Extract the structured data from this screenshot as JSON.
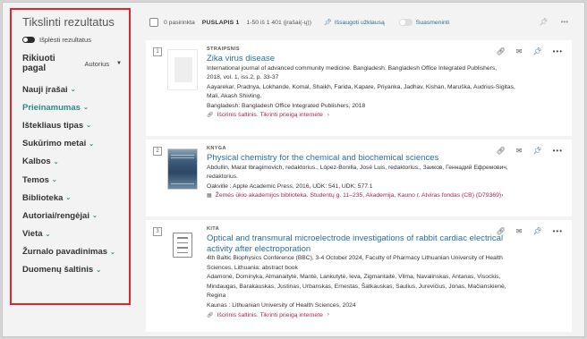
{
  "sidebar": {
    "title": "Tikslinti rezultatus",
    "expand_label": "Išplėsti rezultatus",
    "sort_label": "Rikiuoti pagal",
    "sort_value": "Autorius",
    "facets": [
      {
        "label": "Nauji įrašai",
        "active": false
      },
      {
        "label": "Prieinamumas",
        "active": true
      },
      {
        "label": "Ištekliaus tipas",
        "active": false
      },
      {
        "label": "Sukūrimo metai",
        "active": false
      },
      {
        "label": "Kalbos",
        "active": false
      },
      {
        "label": "Temos",
        "active": false
      },
      {
        "label": "Biblioteka",
        "active": false
      },
      {
        "label": "Autoriai/rengėjai",
        "active": false
      },
      {
        "label": "Vieta",
        "active": false
      },
      {
        "label": "Žurnalo pavadinimas",
        "active": false
      },
      {
        "label": "Duomenų šaltinis",
        "active": false
      }
    ]
  },
  "toolbar": {
    "selected": "0 pasirinkta",
    "page": "PUSLAPIS 1",
    "range": "1-50 iš 1 401 (įrašai(-ų))",
    "save_query": "Išsaugoti užklausą",
    "personalize": "Suasmeninti"
  },
  "results": [
    {
      "num": "1",
      "type": "STRAIPSNIS",
      "title": "Zika virus disease",
      "lines": [
        "International journal of advanced community medicine. Bangladesh: Bangladesh Office Integrated Publishers,",
        "2018, vol. 1, iss.2, p. 33-37",
        "Aayarekar, Pradnya, Lokhande, Komal, Shaikh, Farida, Kapare, Priyanka, Jadhav, Kishan, Maruška, Audrius-Sigitas,",
        "Mali, Akash Shivling.",
        "Bangladesh: Bangladesh Office Integrated Publishers, 2018"
      ],
      "link": "Išorinis šaltinis. Tikrinti prieigą internete"
    },
    {
      "num": "2",
      "type": "KNYGA",
      "title": "Physical chemistry for the chemical and biochemical sciences",
      "lines": [
        "Abdullin, Marat Ibragimovich, redaktorius., López-Bonilla, José Luis, redaktorius., Заиков, Геннадий Ефремович,",
        "redaktorius.",
        "Oakville : Apple Academic Press, 2016, UDK: 541, UDK: 577.1"
      ],
      "link": "Žemės ūkio akademijos biblioteka. Studentų g. 11–235, Akademija, Kauno r. Atviras fondas (CB) (D79369)"
    },
    {
      "num": "3",
      "type": "KITA",
      "title_1": "Optical and transmural microelectrode investigations of rabbit cardiac electrical",
      "title_2": "activity after electroporation",
      "lines": [
        "4th Baltic Biophysics Conference (BBC), 3-4 October 2024, Faculty of Pharmacy Lithuanian University of Health",
        "Sciences, Lithuania: abstract book",
        "Adamonė, Dominyka, Almanaitytė, Mantė, Lankutytė, Ieva, Zigmantaitė, Vilma, Navalinskas, Antanas, Visockis,",
        "Mindaugas, Barakauskas, Justinas, Urbanskas, Ernestas, Šatkauskas, Saulius, Jurevičius, Jonas, Mačianskienė,",
        "Regina",
        "Kaunas : Lithuanian University of Health Sciences, 2024"
      ],
      "link": "Išorinis šaltinis. Tikrinti prieigą internete"
    }
  ],
  "colors": {
    "accent": "#2b8a84",
    "link": "#2b6f9a",
    "availability": "#a7255e",
    "highlight_border": "#e0262a"
  }
}
